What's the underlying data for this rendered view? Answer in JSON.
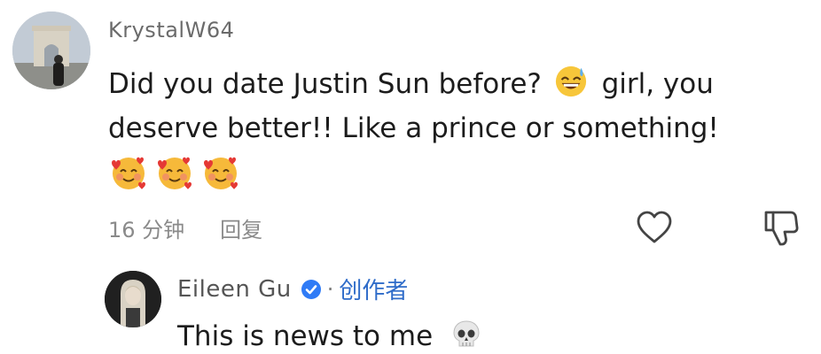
{
  "comment": {
    "username": "KrystalW64",
    "text_line1_before_emoji": "Did you date Justin Sun before?",
    "inline_emoji": "grinning-sweat-emoji",
    "text_line1_after_emoji": "girl, you",
    "text_line2": "deserve better!! Like a prince or something!",
    "emoji_row": [
      "smiling-face-with-hearts-emoji",
      "smiling-face-with-hearts-emoji",
      "smiling-face-with-hearts-emoji"
    ],
    "time": "16 分钟",
    "reply_label": "回复",
    "like_icon": "heart-outline-icon",
    "dislike_icon": "thumbs-down-outline-icon"
  },
  "reply": {
    "username": "Eileen Gu",
    "verified_icon": "verified-check-icon",
    "separator": "·",
    "creator_label": "创作者",
    "text": "This is news to me",
    "emoji": "skull-emoji"
  },
  "colors": {
    "text_primary": "#1c1c1c",
    "text_secondary": "#8a8a8a",
    "creator_blue": "#2f6cc9",
    "verified_blue": "#2f7bf6"
  }
}
